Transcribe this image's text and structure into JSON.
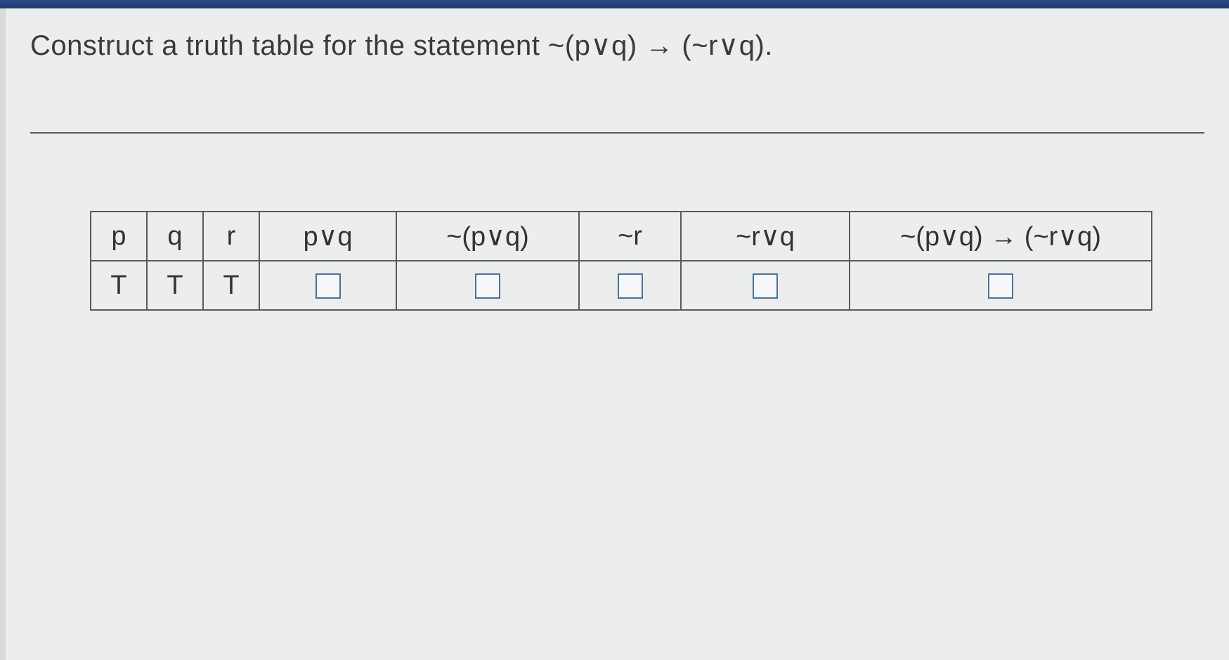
{
  "prompt": "Construct a truth table for the statement ~(p∨q) → (~r∨q).",
  "table": {
    "headers": [
      "p",
      "q",
      "r",
      "p∨q",
      "~(p∨q)",
      "~r",
      "~r∨q",
      "~(p∨q) → (~r∨q)"
    ],
    "rows": [
      {
        "p": "T",
        "q": "T",
        "r": "T",
        "pvq": "",
        "not_pvq": "",
        "not_r": "",
        "notr_v_q": "",
        "result": ""
      }
    ]
  }
}
